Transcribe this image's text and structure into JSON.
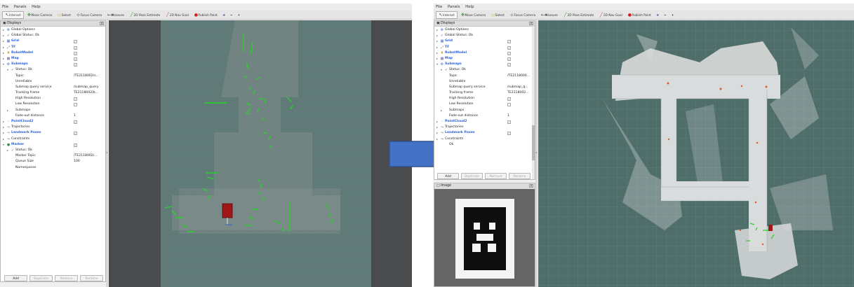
{
  "menu": [
    "File",
    "Panels",
    "Help"
  ],
  "toolbar": [
    {
      "label": "Interact",
      "icon": "pointer-icon",
      "active": true
    },
    {
      "label": "Move Camera",
      "icon": "move-camera-icon"
    },
    {
      "label": "Select",
      "icon": "select-icon"
    },
    {
      "label": "Focus Camera",
      "icon": "focus-camera-icon"
    },
    {
      "label": "Measure",
      "icon": "measure-icon"
    },
    {
      "label": "2D Pose Estimate",
      "icon": "pose-estimate-icon"
    },
    {
      "label": "2D Nav Goal",
      "icon": "nav-goal-icon"
    },
    {
      "label": "Publish Point",
      "icon": "publish-point-icon"
    }
  ],
  "displays_title": "Displays",
  "left_tree": [
    {
      "label": "Global Options"
    },
    {
      "label": "Global Status: Ok"
    },
    {
      "label": "Grid",
      "checked": true
    },
    {
      "label": "TF",
      "checked": true
    },
    {
      "label": "RobotModel",
      "checked": true
    },
    {
      "label": "Map",
      "checked": true
    },
    {
      "label": "Submaps",
      "checked": true
    },
    {
      "label": "Status: Ok"
    },
    {
      "label": "Topic",
      "value": "/TE2118002/s..."
    },
    {
      "label": "Unreliable"
    },
    {
      "label": "Submap query service",
      "value": "/submap_query"
    },
    {
      "label": "Tracking frame",
      "value": "TE2118002/b..."
    },
    {
      "label": "High Resolution",
      "checked": true
    },
    {
      "label": "Low Resolution",
      "checked": false
    },
    {
      "label": "Submaps"
    },
    {
      "label": "Fade-out distance",
      "value": "1"
    },
    {
      "label": "PointCloud2",
      "checked": true
    },
    {
      "label": "Trajectories"
    },
    {
      "label": "Landmark Poses",
      "checked": true
    },
    {
      "label": "Constraints"
    },
    {
      "label": "Marker",
      "checked": true
    },
    {
      "label": "Status: Ok"
    },
    {
      "label": "Marker Topic",
      "value": "/TE2118002/..."
    },
    {
      "label": "Queue Size",
      "value": "100"
    },
    {
      "label": "Namespaces"
    }
  ],
  "right_tree": [
    {
      "label": "Global Options"
    },
    {
      "label": "Global Status: Ok"
    },
    {
      "label": "Grid",
      "checked": true
    },
    {
      "label": "TF",
      "checked": true
    },
    {
      "label": "RobotModel",
      "checked": true
    },
    {
      "label": "Map",
      "checked": true
    },
    {
      "label": "Submaps",
      "checked": true
    },
    {
      "label": "Status: Ok"
    },
    {
      "label": "Topic",
      "value": "/TE2118000..."
    },
    {
      "label": "Unreliable"
    },
    {
      "label": "Submap query service",
      "value": "/submap_q..."
    },
    {
      "label": "Tracking frame",
      "value": "TE2118002..."
    },
    {
      "label": "High Resolution",
      "checked": true
    },
    {
      "label": "Low Resolution",
      "checked": false
    },
    {
      "label": "Submaps"
    },
    {
      "label": "Fade-out distance",
      "value": "1"
    },
    {
      "label": "PointCloud2",
      "checked": true
    },
    {
      "label": "Trajectories"
    },
    {
      "label": "Landmark Poses",
      "checked": true
    },
    {
      "label": "Constraints"
    },
    {
      "label": "Ok"
    }
  ],
  "buttons": {
    "add": "Add",
    "duplicate": "Duplicate",
    "remove": "Remove",
    "rename": "Rename"
  },
  "image_panel_title": "Image"
}
